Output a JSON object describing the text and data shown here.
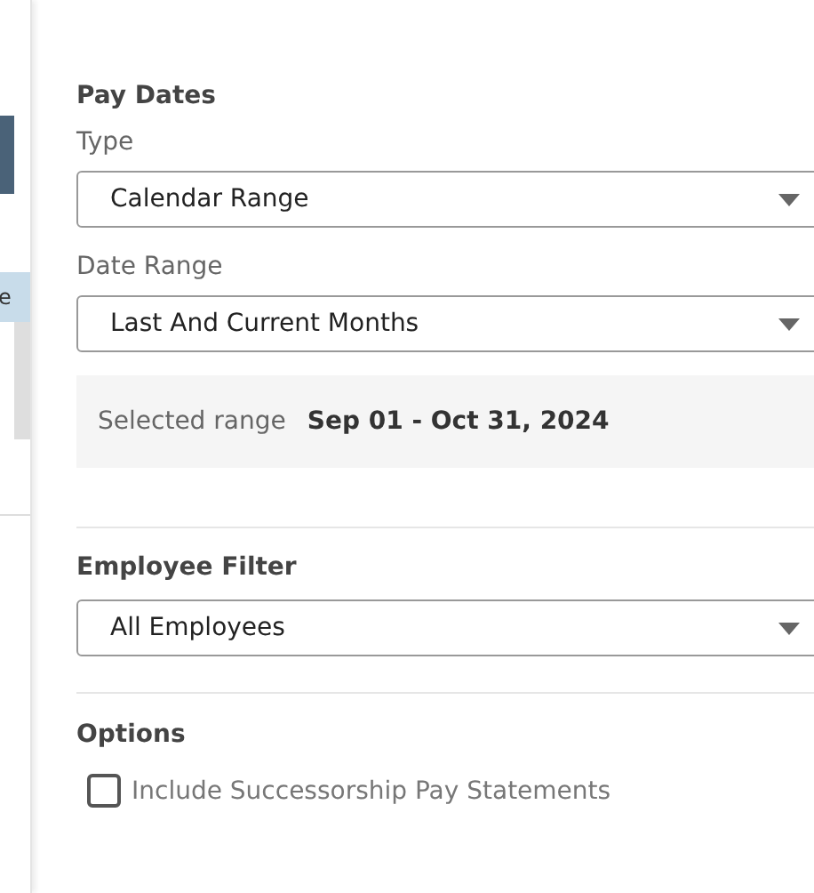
{
  "background_fragment": {
    "text": "e"
  },
  "pay_dates": {
    "title": "Pay Dates",
    "type_label": "Type",
    "type_value": "Calendar Range",
    "date_range_label": "Date Range",
    "date_range_value": "Last And Current Months",
    "selected_range_label": "Selected range",
    "selected_range_value": "Sep 01 - Oct 31, 2024"
  },
  "employee_filter": {
    "title": "Employee Filter",
    "value": "All Employees"
  },
  "options": {
    "title": "Options",
    "items": [
      {
        "label": "Include Successorship Pay Statements",
        "checked": false
      }
    ]
  }
}
